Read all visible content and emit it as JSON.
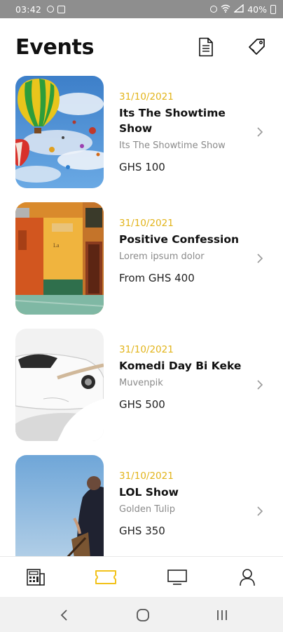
{
  "status_bar": {
    "time": "03:42",
    "battery": "40%"
  },
  "header": {
    "title": "Events"
  },
  "events": [
    {
      "date": "31/10/2021",
      "title_line1": "Its The Showtime",
      "title_line2": "Show",
      "venue": "Its The Showtime Show",
      "price": "GHS 100"
    },
    {
      "date": "31/10/2021",
      "title_line1": "Positive Confession",
      "title_line2": "",
      "venue": "Lorem ipsum dolor",
      "price": "From GHS 400"
    },
    {
      "date": "31/10/2021",
      "title_line1": "Komedi Day Bi Keke",
      "title_line2": "",
      "venue": "Muvenpik",
      "price": "GHS 500"
    },
    {
      "date": "31/10/2021",
      "title_line1": "LOL Show",
      "title_line2": "",
      "venue": "Golden Tulip",
      "price": "GHS 350"
    }
  ],
  "colors": {
    "accent": "#f2c21b",
    "date": "#e2b41a"
  },
  "icons": {
    "header": [
      "document-icon",
      "tag-icon"
    ],
    "bottom_nav": [
      "calendar-icon",
      "ticket-icon",
      "tv-icon",
      "profile-icon"
    ],
    "system_nav": [
      "back-icon",
      "home-icon",
      "recents-icon"
    ]
  },
  "bottom_nav": {
    "active": "ticket-icon"
  }
}
